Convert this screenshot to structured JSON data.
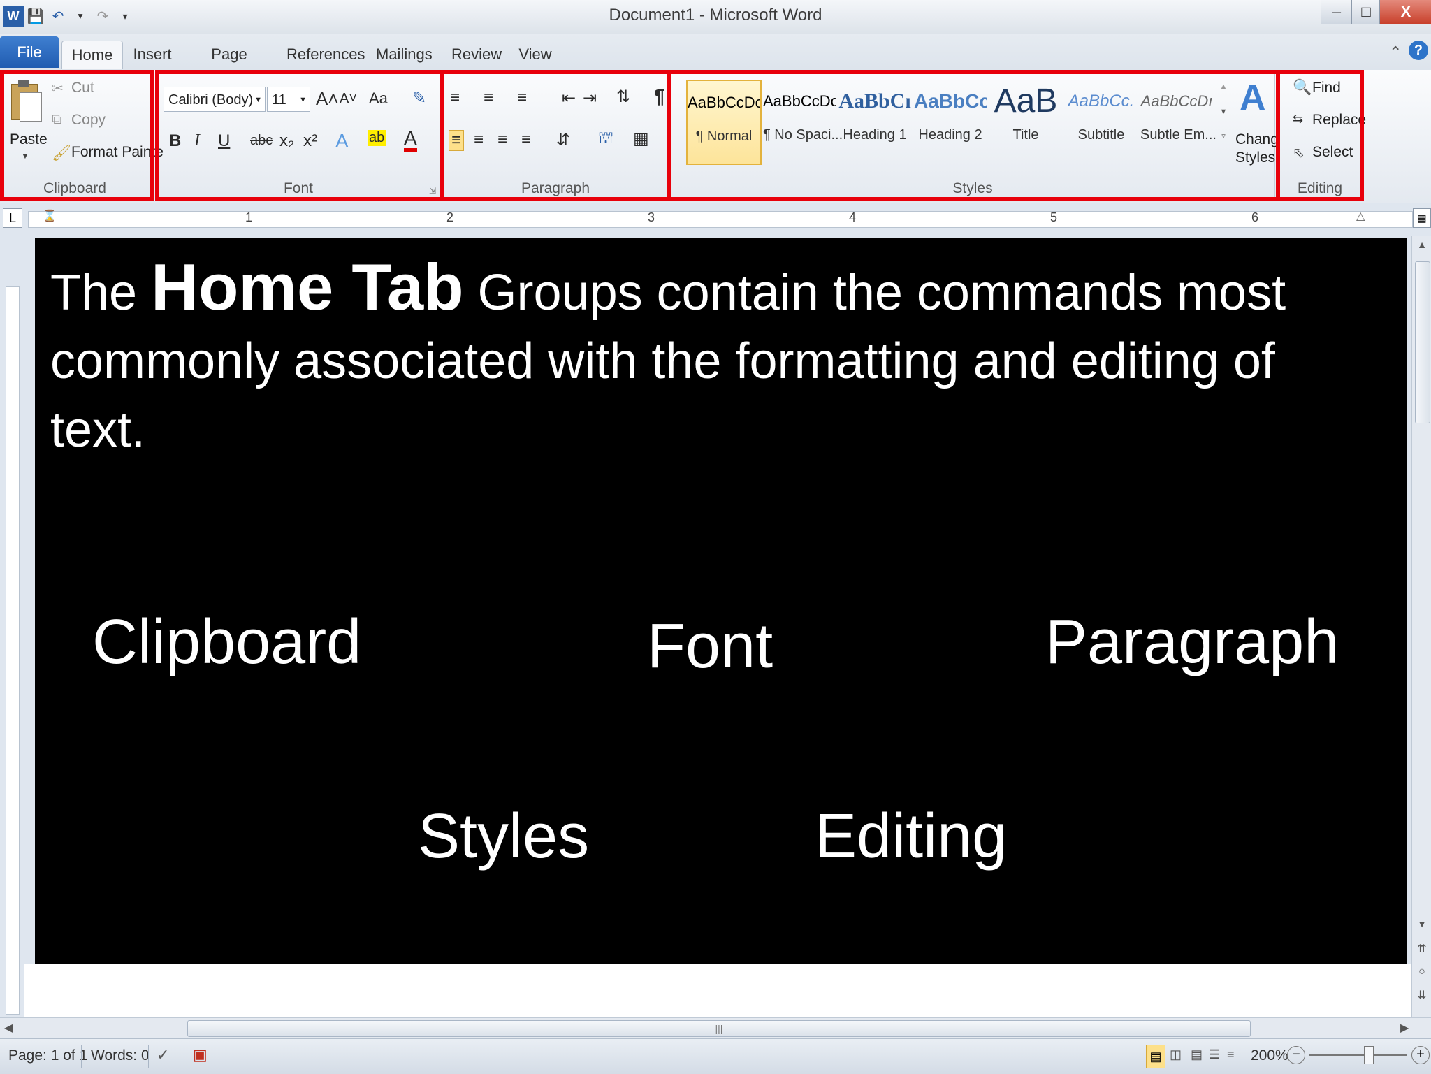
{
  "window": {
    "title": "Document1 - Microsoft Word",
    "qat_icons": [
      "word-icon",
      "save-icon",
      "undo-icon",
      "redo-icon",
      "customize-icon"
    ],
    "controls": {
      "minimize": "–",
      "maximize": "□",
      "close": "X"
    }
  },
  "tabs": [
    "File",
    "Home",
    "Insert",
    "Page Layout",
    "References",
    "Mailings",
    "Review",
    "View"
  ],
  "ribbon": {
    "clipboard": {
      "label": "Clipboard",
      "paste": "Paste",
      "cut": "Cut",
      "copy": "Copy",
      "format_painter": "Format Painte"
    },
    "font": {
      "label": "Font",
      "font_name": "Calibri (Body)",
      "font_size": "11",
      "grow": "A˄",
      "shrink": "A˅",
      "change_case": "Aa",
      "bold": "B",
      "italic": "I",
      "underline": "U",
      "strikethrough": "abc",
      "subscript": "x₂",
      "superscript": "x²",
      "text_effects": "A",
      "highlight": "ab",
      "font_color": "A"
    },
    "paragraph": {
      "label": "Paragraph",
      "pilcrow": "¶"
    },
    "styles": {
      "label": "Styles",
      "items": [
        {
          "sample": "AaBbCcDc",
          "name": "¶ Normal"
        },
        {
          "sample": "AaBbCcDc",
          "name": "¶ No Spaci..."
        },
        {
          "sample": "AaBbCı",
          "name": "Heading 1"
        },
        {
          "sample": "AaBbCc",
          "name": "Heading 2"
        },
        {
          "sample": "AaB",
          "name": "Title"
        },
        {
          "sample": "AaBbCc.",
          "name": "Subtitle"
        },
        {
          "sample": "AaBbCcDı",
          "name": "Subtle Em..."
        }
      ],
      "change_styles_line1": "Chang",
      "change_styles_line2": "Styles"
    },
    "editing": {
      "label": "Editing",
      "find": "Find",
      "replace": "Replace",
      "select": "Select"
    }
  },
  "ruler": {
    "numbers": [
      "1",
      "2",
      "3",
      "4",
      "5",
      "6"
    ]
  },
  "document": {
    "line_prefix": "The",
    "emphasis": "Home Tab",
    "line_rest": "Groups contain the commands most commonly associated with the formatting and editing of text.",
    "groups": [
      "Clipboard",
      "Font",
      "Paragraph",
      "Styles",
      "Editing"
    ]
  },
  "status": {
    "page": "Page: 1 of 1",
    "words": "Words: 0",
    "zoom": "200%"
  },
  "colors": {
    "highlight_box": "#e8000b",
    "file_tab": "#2a68bf",
    "page_bg": "#000000"
  }
}
